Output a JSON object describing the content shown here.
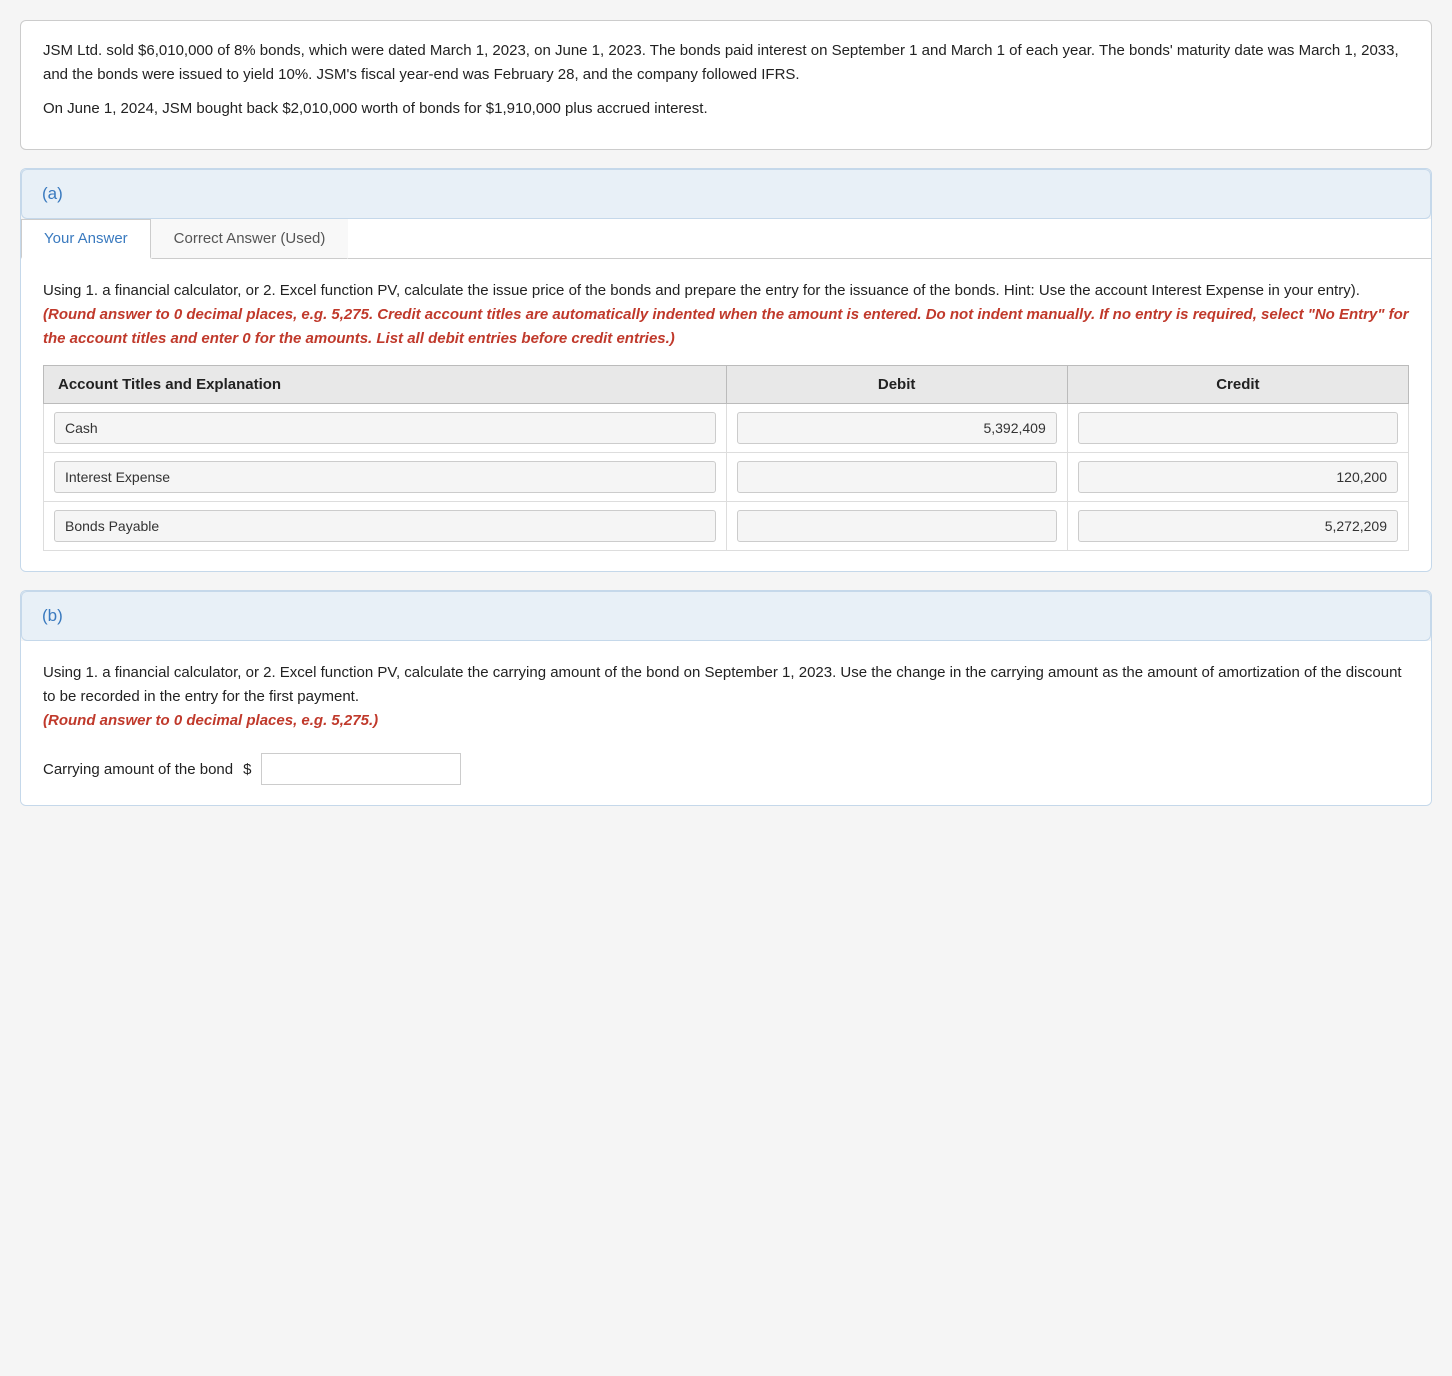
{
  "problem": {
    "description": "JSM Ltd. sold $6,010,000 of 8% bonds, which were dated March 1, 2023, on June 1, 2023. The bonds paid interest on September 1 and March 1 of each year. The bonds' maturity date was March 1, 2033, and the bonds were issued to yield 10%. JSM's fiscal year-end was February 28, and the company followed IFRS.",
    "description2": "On June 1, 2024, JSM bought back $2,010,000 worth of bonds for $1,910,000 plus accrued interest."
  },
  "section_a": {
    "label": "(a)",
    "tabs": {
      "your_answer": "Your Answer",
      "correct_answer": "Correct Answer (Used)"
    },
    "instruction": "Using 1. a financial calculator, or 2. Excel function PV, calculate the issue price of the bonds and prepare the entry for the issuance of the bonds. Hint: Use the account Interest Expense in your entry).",
    "instruction_red": "(Round answer to 0 decimal places, e.g. 5,275. Credit account titles are automatically indented when the amount is entered. Do not indent manually. If no entry is required, select \"No Entry\" for the account titles and enter 0 for the amounts. List all debit entries before credit entries.)",
    "table": {
      "headers": [
        "Account Titles and Explanation",
        "Debit",
        "Credit"
      ],
      "rows": [
        {
          "account": "Cash",
          "debit": "5,392,409",
          "credit": ""
        },
        {
          "account": "Interest Expense",
          "debit": "",
          "credit": "120,200"
        },
        {
          "account": "Bonds Payable",
          "debit": "",
          "credit": "5,272,209"
        }
      ]
    }
  },
  "section_b": {
    "label": "(b)",
    "instruction": "Using 1. a financial calculator, or 2. Excel function PV, calculate the carrying amount of the bond on September 1, 2023. Use the change in the carrying amount as the amount of amortization of the discount to be recorded in the entry for the first payment.",
    "instruction_red": "(Round answer to 0 decimal places, e.g. 5,275.)",
    "carrying_amount_label": "Carrying amount of the bond",
    "dollar_sign": "$",
    "carrying_amount_value": ""
  }
}
